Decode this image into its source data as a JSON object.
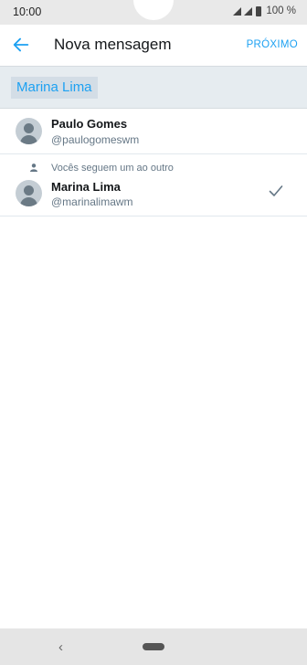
{
  "status": {
    "time": "10:00",
    "battery": "100 %"
  },
  "header": {
    "title": "Nova mensagem",
    "next_label": "PRÓXIMO"
  },
  "search": {
    "chip_label": "Marina Lima"
  },
  "results": [
    {
      "name": "Paulo Gomes",
      "handle": "@paulogomeswm"
    },
    {
      "follow_note": "Vocês seguem um ao outro",
      "name": "Marina Lima",
      "handle": "@marinalimawm",
      "selected": true
    }
  ],
  "colors": {
    "accent": "#1da1f2",
    "secondary_text": "#657786",
    "search_bg": "#e6ecf0"
  },
  "icons": {
    "back": "arrow-left-icon",
    "check": "check-icon",
    "follow": "person-icon",
    "avatar": "default-avatar-icon"
  }
}
